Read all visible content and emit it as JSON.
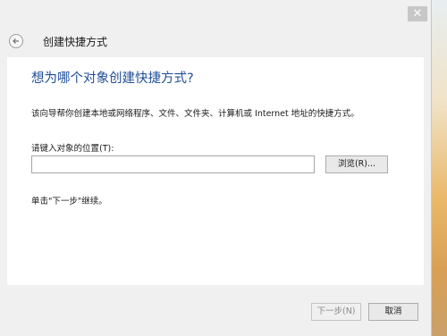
{
  "window": {
    "close_icon": "close-icon",
    "close_glyph": "✕"
  },
  "header": {
    "back_icon": "back-arrow-icon",
    "title": "创建快捷方式"
  },
  "main": {
    "heading": "想为哪个对象创建快捷方式?",
    "description": "该向导帮你创建本地或网络程序、文件、文件夹、计算机或 Internet 地址的快捷方式。",
    "location_label": "请键入对象的位置(T):",
    "location_value": "",
    "browse_label": "浏览(R)...",
    "hint": "单击\"下一步\"继续。"
  },
  "footer": {
    "next_label": "下一步(N)",
    "cancel_label": "取消"
  },
  "colors": {
    "heading": "#1f4e99",
    "dialog_bg": "#f0f0f0",
    "content_bg": "#ffffff"
  }
}
